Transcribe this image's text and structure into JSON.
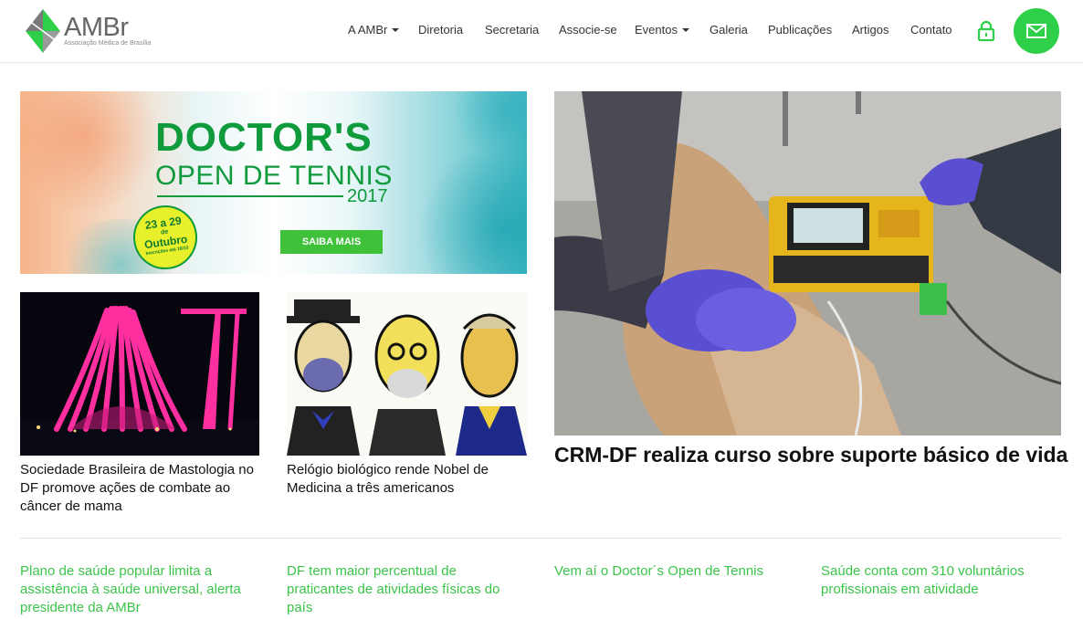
{
  "brand": {
    "name": "AMBr",
    "tagline": "Associação Médica de Brasília",
    "accent": "#2ed04a"
  },
  "nav": {
    "items": [
      {
        "label": "A AMBr",
        "dropdown": true
      },
      {
        "label": "Diretoria",
        "dropdown": false
      },
      {
        "label": "Secretaria",
        "dropdown": false
      },
      {
        "label": "Associe-se",
        "dropdown": false
      },
      {
        "label": "Eventos",
        "dropdown": true
      },
      {
        "label": "Galeria",
        "dropdown": false
      },
      {
        "label": "Publicações",
        "dropdown": false
      },
      {
        "label": "Artigos",
        "dropdown": false
      },
      {
        "label": "Contato",
        "dropdown": false
      }
    ],
    "icons": [
      "lock-icon",
      "mail-icon"
    ]
  },
  "banner": {
    "title_line1": "DOCTOR'S",
    "title_line2": "OPEN DE TENNIS",
    "year": "2017",
    "date_line1": "23 a 29",
    "date_line2": "de",
    "date_line3": "Outubro",
    "date_line4": "Inscrições até 18/10",
    "cta": "SAIBA MAIS"
  },
  "featured": {
    "cards": [
      {
        "title": "Sociedade Brasileira de Mastologia no DF promove ações de combate ao câncer de mama"
      },
      {
        "title": "Relógio biológico rende Nobel de Medicina a três americanos"
      }
    ],
    "hero_title": "CRM-DF realiza curso sobre suporte básico de vida"
  },
  "bottom_links": [
    "Plano de saúde popular limita a assistência à saúde universal, alerta presidente da AMBr",
    "DF tem maior percentual de praticantes de atividades físicas do país",
    "Vem aí o Doctor´s Open de Tennis",
    "Saúde conta com 310 voluntários profissionais em atividade"
  ]
}
